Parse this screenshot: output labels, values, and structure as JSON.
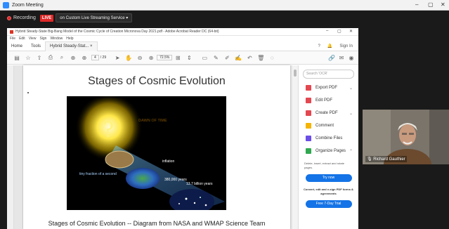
{
  "zoom": {
    "window_title": "Zoom Meeting",
    "recording_label": "Recording",
    "live_badge": "LIVE",
    "stream_label": "on Custom Live Streaming Service",
    "participant_name": "Richard Gauthier"
  },
  "acrobat": {
    "window_title": "Hybrid Steady-State Big-Bang Model of the Cosmic Cycle of Creation Micronova Day 2021.pdf - Adobe Acrobat Reader DC (64-bit)",
    "menu": [
      "File",
      "Edit",
      "View",
      "Sign",
      "Window",
      "Help"
    ],
    "tabs": [
      "Home",
      "Tools",
      "Hybrid Steady-Stat... ×"
    ],
    "sign_in": "Sign In",
    "page_current": "4",
    "page_total": "/ 29",
    "zoom_level": "72.5%",
    "side_panel": {
      "search_placeholder": "Search 'OCR'",
      "items": [
        {
          "label": "Export PDF",
          "color": "#e34850",
          "has_chevron": true
        },
        {
          "label": "Edit PDF",
          "color": "#e34850",
          "has_chevron": false
        },
        {
          "label": "Create PDF",
          "color": "#e34850",
          "has_chevron": true
        },
        {
          "label": "Comment",
          "color": "#f5b400",
          "has_chevron": false
        },
        {
          "label": "Combine Files",
          "color": "#6b4ee6",
          "has_chevron": false
        },
        {
          "label": "Organize Pages",
          "color": "#2fa84f",
          "has_chevron": true
        }
      ],
      "description": "Delete, insert, extract and rotate pages.",
      "try_now": "Try now",
      "promo": "Convert, edit and e-sign PDF forms & agreements",
      "free_trial": "Free 7-Day Trial"
    }
  },
  "pdf": {
    "slide_title": "Stages of Cosmic Evolution",
    "caption": "Stages of Cosmic Evolution -- Diagram from NASA and WMAP Science Team",
    "figure_labels": {
      "dawn": "DAWN OF TIME",
      "inflation": "inflation",
      "tiny_fraction": "tiny fraction of a second",
      "years_380k": "380,000 years",
      "years_13_7": "13.7 billion years"
    }
  }
}
